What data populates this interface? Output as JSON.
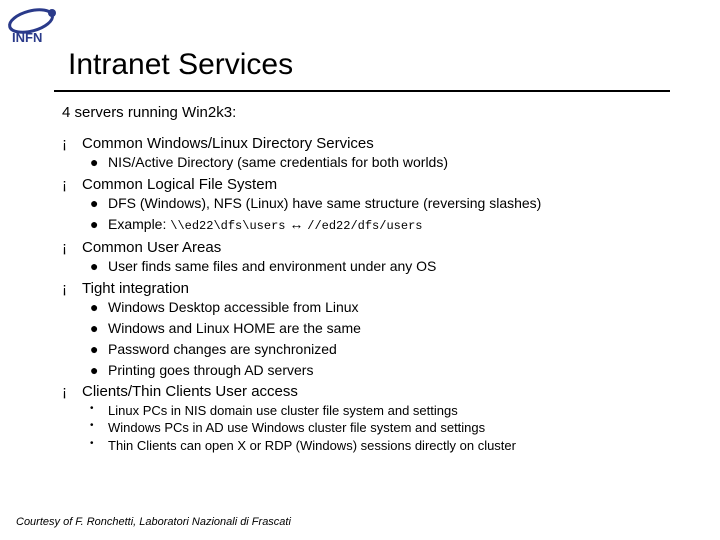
{
  "logo": {
    "text": "INFN"
  },
  "title": "Intranet Services",
  "subtitle": "4 servers running Win2k3:",
  "items": [
    {
      "label": "Common Windows/Linux Directory Services",
      "subs": [
        {
          "bullet": "●",
          "text": "NIS/Active Directory (same credentials for both worlds)"
        }
      ]
    },
    {
      "label": "Common Logical File System",
      "subs": [
        {
          "bullet": "●",
          "text": "DFS (Windows), NFS (Linux) have same structure (reversing slashes)"
        },
        {
          "bullet": "●",
          "text": "Example:",
          "code1": "\\\\ed22\\dfs\\users",
          "arrow": "↔",
          "code2": "//ed22/dfs/users"
        }
      ]
    },
    {
      "label": "Common User Areas",
      "subs": [
        {
          "bullet": "●",
          "text": "User finds same files and environment under any OS"
        }
      ]
    },
    {
      "label": "Tight integration",
      "subs": [
        {
          "bullet": "●",
          "text": "Windows Desktop accessible from Linux"
        },
        {
          "bullet": "●",
          "text": "Windows and Linux HOME are the same"
        },
        {
          "bullet": "●",
          "text": "Password changes are synchronized"
        },
        {
          "bullet": "●",
          "text": "Printing goes through AD servers"
        }
      ]
    },
    {
      "label": "Clients/Thin Clients User access",
      "subs": [
        {
          "bullet": "•",
          "text": "Linux PCs in NIS domain use cluster file system and settings"
        },
        {
          "bullet": "•",
          "text": "Windows PCs in AD use Windows cluster file system and settings"
        },
        {
          "bullet": "•",
          "text": "Thin Clients can open X or RDP (Windows) sessions directly on cluster"
        }
      ]
    }
  ],
  "footer": "Courtesy of F. Ronchetti, Laboratori Nazionali di Frascati"
}
